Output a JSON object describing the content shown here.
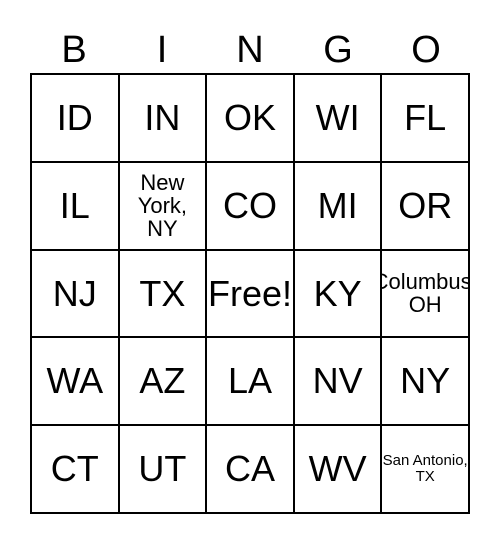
{
  "header": [
    "B",
    "I",
    "N",
    "G",
    "O"
  ],
  "cells": [
    [
      "ID",
      "IN",
      "OK",
      "WI",
      "FL"
    ],
    [
      "IL",
      "New York, NY",
      "CO",
      "MI",
      "OR"
    ],
    [
      "NJ",
      "TX",
      "Free!",
      "KY",
      "Columbus, OH"
    ],
    [
      "WA",
      "AZ",
      "LA",
      "NV",
      "NY"
    ],
    [
      "CT",
      "UT",
      "CA",
      "WV",
      "San Antonio, TX"
    ]
  ]
}
